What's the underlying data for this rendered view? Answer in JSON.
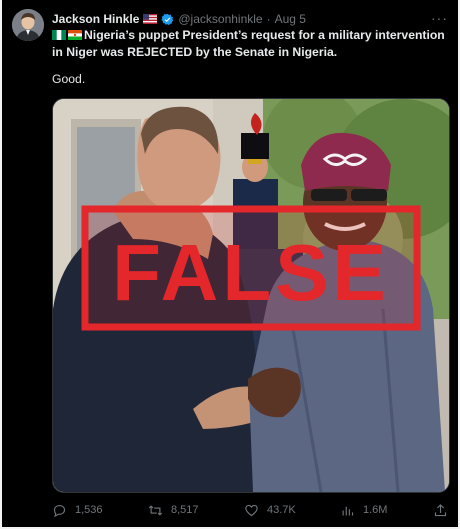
{
  "tweet": {
    "author_name": "Jackson Hinkle",
    "handle": "@jacksonhinkle",
    "separator": "·",
    "date": "Aug 5",
    "text": "Nigeria’s puppet President’s request for a military intervention in Niger was REJECTED by the Senate in Nigeria.",
    "text2": "Good.",
    "image_stamp": "FALSE"
  },
  "actions": {
    "replies": "1,536",
    "retweets": "8,517",
    "likes": "43.7K",
    "views": "1.6M"
  },
  "icons": {
    "more": "more-icon",
    "reply": "reply-icon",
    "retweet": "retweet-icon",
    "like": "heart-icon",
    "views": "views-icon",
    "share": "share-icon"
  },
  "colors": {
    "background": "#000000",
    "text": "#e7e9ea",
    "muted": "#71767b",
    "verified": "#1d9bf0",
    "stamp": "#e3272b"
  }
}
